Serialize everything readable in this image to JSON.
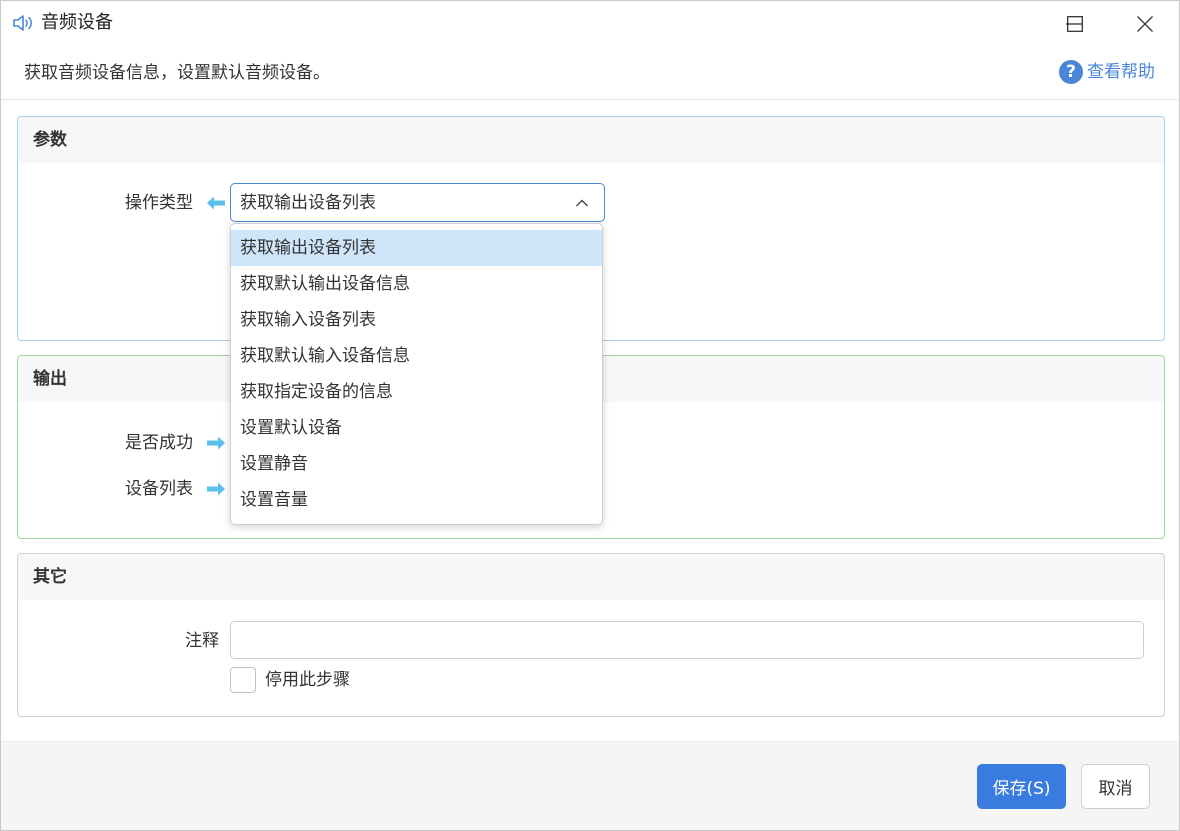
{
  "window": {
    "title": "音频设备",
    "icon": "speaker-icon",
    "controls": {
      "minimize": "minimize-icon",
      "maximize": "maximize-icon",
      "close": "close-icon"
    }
  },
  "header": {
    "description": "获取音频设备信息，设置默认音频设备。",
    "help_label": "查看帮助",
    "help_icon_glyph": "?"
  },
  "params": {
    "title": "参数",
    "operation_label": "操作类型",
    "operation_value": "获取输出设备列表",
    "dropdown_open": true,
    "options": [
      "获取输出设备列表",
      "获取默认输出设备信息",
      "获取输入设备列表",
      "获取默认输入设备信息",
      "获取指定设备的信息",
      "设置默认设备",
      "设置静音",
      "设置音量"
    ],
    "selected_index": 0
  },
  "output": {
    "title": "输出",
    "success_label": "是否成功",
    "device_list_label": "设备列表"
  },
  "other": {
    "title": "其它",
    "comment_label": "注释",
    "comment_value": "",
    "disable_step_label": "停用此步骤",
    "disable_step_checked": false
  },
  "footer": {
    "save_label": "保存(S)",
    "cancel_label": "取消"
  },
  "colors": {
    "accent": "#3a7be0",
    "help": "#4a86d8",
    "params_border": "#a8d0f0",
    "output_border": "#9ed89e",
    "arrow": "#5bc0eb",
    "selected_option_bg": "#cfe5fa"
  }
}
